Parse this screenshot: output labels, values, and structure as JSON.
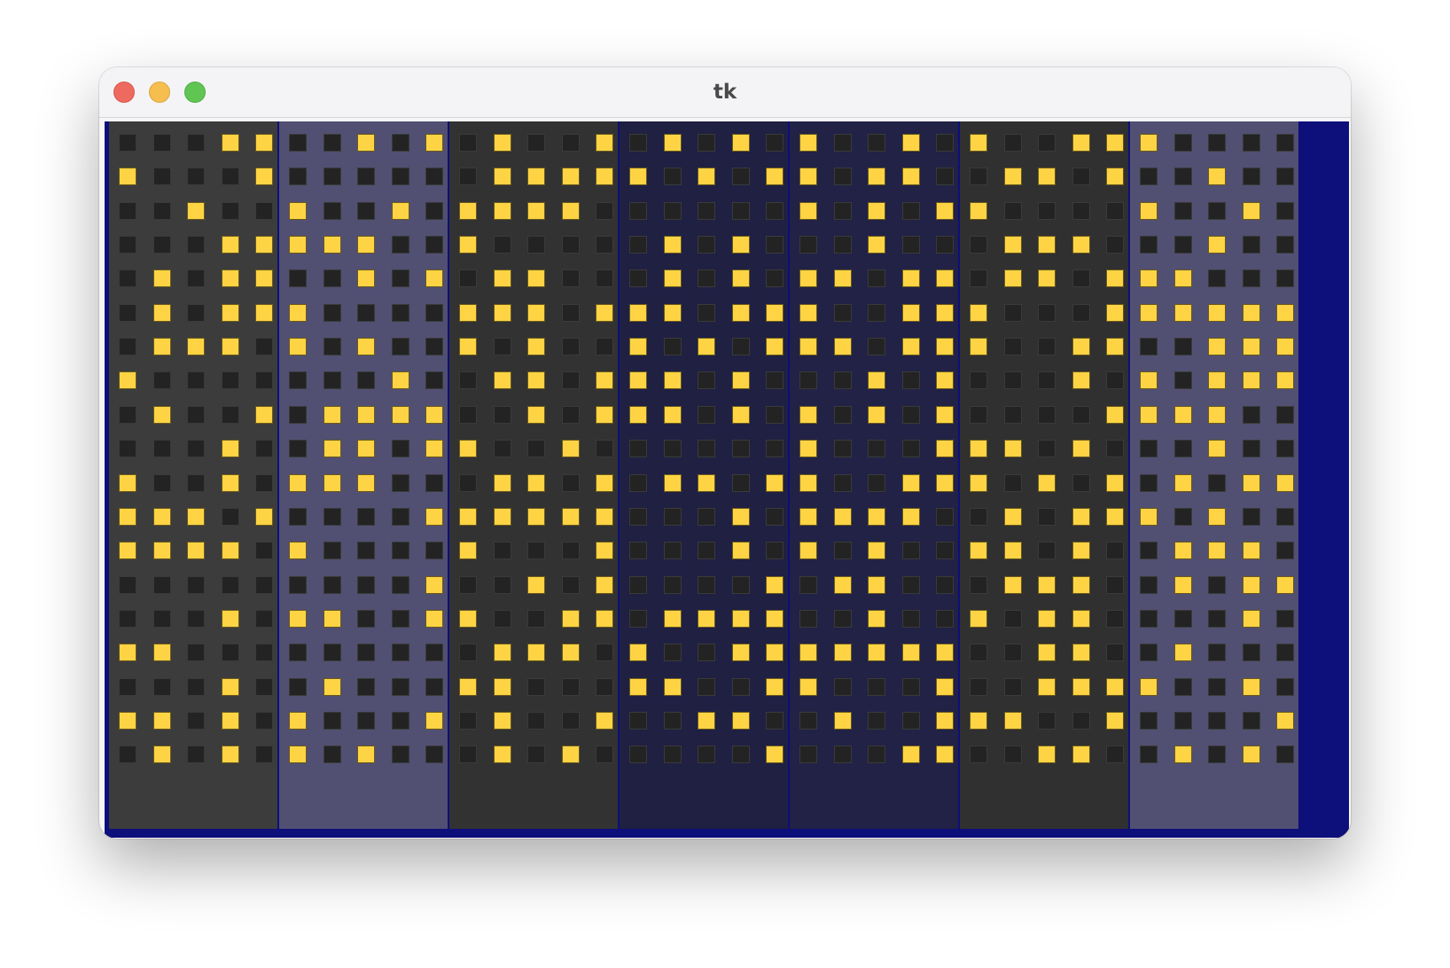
{
  "window": {
    "title": "tk",
    "controls": [
      "close-icon",
      "minimize-icon",
      "maximize-icon"
    ]
  },
  "scene": {
    "colors": {
      "sky": "#0d0f7a",
      "lit_window": "#fed445",
      "dark_window": "#232323"
    },
    "buildings": [
      {
        "color": "#3c3c3c",
        "rows": [
          [
            0,
            0,
            0,
            1,
            1
          ],
          [
            1,
            0,
            0,
            0,
            1
          ],
          [
            0,
            0,
            1,
            0,
            0
          ],
          [
            0,
            0,
            0,
            1,
            1
          ],
          [
            0,
            1,
            0,
            1,
            1
          ],
          [
            0,
            1,
            0,
            1,
            1
          ],
          [
            0,
            1,
            1,
            1,
            0
          ],
          [
            1,
            0,
            0,
            0,
            0
          ],
          [
            0,
            1,
            0,
            0,
            1
          ],
          [
            0,
            0,
            0,
            1,
            0
          ],
          [
            1,
            0,
            0,
            1,
            0
          ],
          [
            1,
            1,
            1,
            0,
            1
          ],
          [
            1,
            1,
            1,
            1,
            0
          ],
          [
            0,
            0,
            0,
            0,
            0
          ],
          [
            0,
            0,
            0,
            1,
            0
          ],
          [
            1,
            1,
            0,
            0,
            0
          ],
          [
            0,
            0,
            0,
            1,
            0
          ],
          [
            1,
            1,
            0,
            1,
            0
          ],
          [
            0,
            1,
            0,
            1,
            0
          ]
        ]
      },
      {
        "color": "#515072",
        "rows": [
          [
            0,
            0,
            1,
            0,
            1
          ],
          [
            0,
            0,
            0,
            0,
            0
          ],
          [
            1,
            0,
            0,
            1,
            0
          ],
          [
            1,
            1,
            1,
            0,
            0
          ],
          [
            0,
            0,
            1,
            0,
            1
          ],
          [
            1,
            0,
            0,
            0,
            0
          ],
          [
            1,
            0,
            1,
            0,
            0
          ],
          [
            0,
            0,
            0,
            1,
            0
          ],
          [
            0,
            1,
            1,
            1,
            1
          ],
          [
            0,
            1,
            1,
            0,
            1
          ],
          [
            1,
            1,
            1,
            0,
            0
          ],
          [
            0,
            0,
            0,
            0,
            1
          ],
          [
            1,
            0,
            0,
            0,
            0
          ],
          [
            0,
            0,
            0,
            0,
            1
          ],
          [
            1,
            1,
            0,
            0,
            1
          ],
          [
            0,
            0,
            0,
            0,
            0
          ],
          [
            0,
            1,
            0,
            0,
            0
          ],
          [
            1,
            0,
            0,
            0,
            1
          ],
          [
            1,
            0,
            1,
            0,
            0
          ]
        ]
      },
      {
        "color": "#323232",
        "rows": [
          [
            0,
            1,
            0,
            0,
            1
          ],
          [
            0,
            1,
            1,
            1,
            1
          ],
          [
            1,
            1,
            1,
            1,
            0
          ],
          [
            1,
            0,
            0,
            0,
            0
          ],
          [
            0,
            1,
            1,
            0,
            0
          ],
          [
            1,
            1,
            1,
            0,
            1
          ],
          [
            1,
            0,
            1,
            0,
            0
          ],
          [
            0,
            1,
            1,
            0,
            1
          ],
          [
            0,
            0,
            1,
            0,
            1
          ],
          [
            1,
            0,
            0,
            1,
            0
          ],
          [
            0,
            1,
            1,
            0,
            1
          ],
          [
            1,
            1,
            1,
            1,
            1
          ],
          [
            1,
            0,
            0,
            0,
            1
          ],
          [
            0,
            0,
            1,
            0,
            1
          ],
          [
            1,
            0,
            0,
            1,
            1
          ],
          [
            0,
            1,
            1,
            1,
            0
          ],
          [
            1,
            1,
            0,
            0,
            0
          ],
          [
            0,
            1,
            0,
            0,
            1
          ],
          [
            0,
            1,
            0,
            1,
            0
          ]
        ]
      },
      {
        "color": "#1f2042",
        "rows": [
          [
            0,
            1,
            0,
            1,
            0
          ],
          [
            1,
            0,
            1,
            0,
            1
          ],
          [
            0,
            0,
            0,
            0,
            0
          ],
          [
            0,
            1,
            0,
            1,
            0
          ],
          [
            0,
            1,
            0,
            1,
            0
          ],
          [
            1,
            1,
            0,
            1,
            1
          ],
          [
            1,
            0,
            1,
            0,
            1
          ],
          [
            1,
            1,
            0,
            1,
            0
          ],
          [
            1,
            1,
            0,
            1,
            0
          ],
          [
            0,
            0,
            0,
            0,
            0
          ],
          [
            0,
            1,
            1,
            0,
            1
          ],
          [
            0,
            0,
            0,
            1,
            0
          ],
          [
            0,
            0,
            0,
            1,
            0
          ],
          [
            0,
            0,
            0,
            0,
            1
          ],
          [
            0,
            1,
            1,
            1,
            1
          ],
          [
            1,
            0,
            0,
            1,
            1
          ],
          [
            1,
            1,
            0,
            0,
            1
          ],
          [
            0,
            0,
            1,
            1,
            0
          ],
          [
            0,
            0,
            0,
            0,
            1
          ]
        ]
      },
      {
        "color": "#212245",
        "rows": [
          [
            1,
            0,
            0,
            1,
            0
          ],
          [
            1,
            0,
            1,
            1,
            0
          ],
          [
            1,
            0,
            1,
            0,
            1
          ],
          [
            0,
            0,
            1,
            0,
            0
          ],
          [
            1,
            1,
            0,
            1,
            1
          ],
          [
            1,
            0,
            0,
            1,
            1
          ],
          [
            1,
            1,
            0,
            1,
            1
          ],
          [
            0,
            0,
            1,
            0,
            1
          ],
          [
            1,
            0,
            1,
            0,
            1
          ],
          [
            1,
            0,
            0,
            0,
            1
          ],
          [
            1,
            0,
            0,
            1,
            1
          ],
          [
            1,
            1,
            1,
            1,
            0
          ],
          [
            1,
            0,
            1,
            0,
            0
          ],
          [
            0,
            1,
            1,
            0,
            0
          ],
          [
            0,
            0,
            1,
            0,
            0
          ],
          [
            1,
            1,
            1,
            1,
            1
          ],
          [
            1,
            0,
            0,
            0,
            1
          ],
          [
            0,
            1,
            0,
            0,
            1
          ],
          [
            0,
            0,
            0,
            1,
            1
          ]
        ]
      },
      {
        "color": "#303030",
        "rows": [
          [
            1,
            0,
            0,
            1,
            1
          ],
          [
            0,
            1,
            1,
            0,
            1
          ],
          [
            1,
            0,
            0,
            0,
            0
          ],
          [
            0,
            1,
            1,
            1,
            0
          ],
          [
            0,
            1,
            1,
            0,
            1
          ],
          [
            1,
            0,
            0,
            0,
            1
          ],
          [
            1,
            0,
            0,
            1,
            1
          ],
          [
            0,
            0,
            0,
            1,
            0
          ],
          [
            0,
            0,
            0,
            0,
            1
          ],
          [
            1,
            1,
            0,
            1,
            0
          ],
          [
            1,
            0,
            1,
            0,
            1
          ],
          [
            0,
            1,
            0,
            1,
            1
          ],
          [
            1,
            1,
            0,
            1,
            0
          ],
          [
            0,
            1,
            1,
            1,
            0
          ],
          [
            1,
            0,
            1,
            1,
            0
          ],
          [
            0,
            0,
            1,
            1,
            0
          ],
          [
            0,
            0,
            1,
            1,
            1
          ],
          [
            1,
            1,
            0,
            0,
            1
          ],
          [
            0,
            0,
            1,
            1,
            0
          ]
        ]
      },
      {
        "color": "#515072",
        "rows": [
          [
            1,
            0,
            0,
            0,
            0
          ],
          [
            0,
            0,
            1,
            0,
            0
          ],
          [
            1,
            0,
            0,
            1,
            0
          ],
          [
            0,
            0,
            1,
            0,
            0
          ],
          [
            1,
            1,
            0,
            0,
            0
          ],
          [
            1,
            1,
            1,
            1,
            1
          ],
          [
            0,
            0,
            1,
            1,
            1
          ],
          [
            1,
            0,
            1,
            1,
            1
          ],
          [
            1,
            1,
            1,
            0,
            0
          ],
          [
            0,
            0,
            1,
            0,
            0
          ],
          [
            0,
            1,
            0,
            1,
            1
          ],
          [
            1,
            0,
            1,
            0,
            0
          ],
          [
            0,
            1,
            1,
            1,
            0
          ],
          [
            0,
            1,
            0,
            1,
            1
          ],
          [
            0,
            0,
            0,
            1,
            0
          ],
          [
            0,
            1,
            0,
            0,
            0
          ],
          [
            1,
            0,
            0,
            1,
            0
          ],
          [
            0,
            0,
            0,
            0,
            1
          ],
          [
            0,
            1,
            0,
            1,
            0
          ]
        ]
      }
    ]
  }
}
